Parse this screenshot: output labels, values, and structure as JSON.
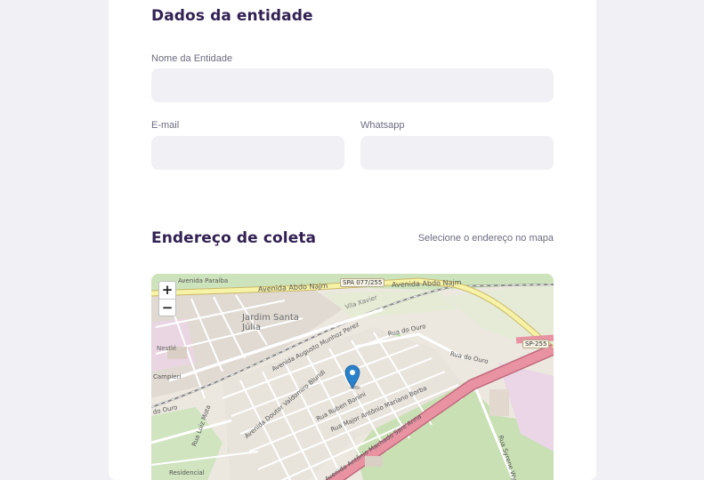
{
  "entity": {
    "title": "Dados da entidade",
    "name_label": "Nome da Entidade",
    "name_value": "",
    "email_label": "E-mail",
    "email_value": "",
    "whatsapp_label": "Whatsapp",
    "whatsapp_value": ""
  },
  "address": {
    "title": "Endereço de coleta",
    "hint": "Selecione o endereço no mapa"
  },
  "map": {
    "zoom_in": "+",
    "zoom_out": "−",
    "labels": {
      "avenida_paraiba": "Avenida Paraíba",
      "avenida_abdo_najm_1": "Avenida Abdo Najm",
      "avenida_abdo_najm_2": "Avenida Abdo Najm",
      "jardim_santa_julia": "Jardim Santa Júlia",
      "vila_xavier": "Vila Xavier",
      "nestle": "Nestlé",
      "rua_do_ouro_1": "Rua do Ouro",
      "rua_do_ouro_2": "Rua do Ouro",
      "avenida_augusto": "Avenida Augusto Munhoz Perez",
      "avenida_doutor": "Avenida Doutor Valdomiro Blundi",
      "rua_ruben": "Rua Ruben Bonini",
      "rua_major": "Rua Major Antônio Mariano Borba",
      "avenida_antonio": "Avenida Antônio Machado Sant'Anna",
      "rua_wyss": "Rua Syrene Wyss B.",
      "residencial": "Residencial",
      "rua_luiz": "Rua Luiz Mota",
      "campieri": "Campieri",
      "do_ouro": "do Ouro",
      "sp_077": "SPA 077/255",
      "sp_255": "SP-255"
    }
  },
  "colors": {
    "title": "#322153",
    "label": "#6c6c80",
    "input_bg": "#f0f0f5",
    "marker": "#2a81cb"
  }
}
